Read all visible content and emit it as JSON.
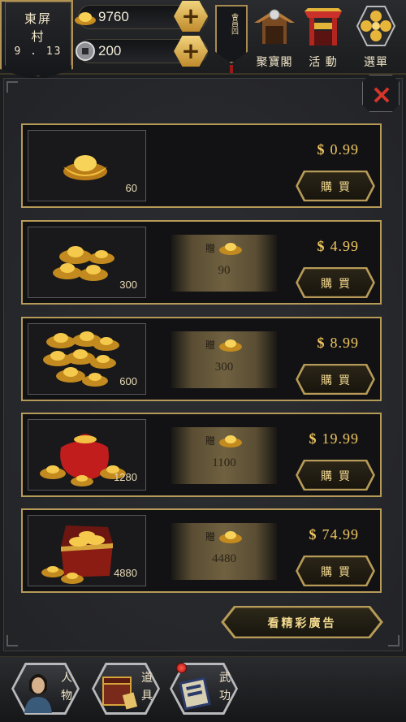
{
  "location": {
    "name_line1": "東屏",
    "name_line2": "村",
    "date": "9 . 13"
  },
  "currencies": {
    "gold": "9760",
    "coin": "200"
  },
  "season": {
    "label": "會員四"
  },
  "top_menu": [
    {
      "label": "聚寶閣",
      "icon": "treasure-pavilion-icon"
    },
    {
      "label": "活 動",
      "icon": "event-gate-icon"
    },
    {
      "label": "選單",
      "icon": "menu-flower-icon"
    }
  ],
  "close_label": "×",
  "offers": [
    {
      "quantity": "60",
      "price": "0.99",
      "bonus": "",
      "buy_label": "購買"
    },
    {
      "quantity": "300",
      "price": "4.99",
      "bonus": "90",
      "buy_label": "購買"
    },
    {
      "quantity": "600",
      "price": "8.99",
      "bonus": "300",
      "buy_label": "購買"
    },
    {
      "quantity": "1280",
      "price": "19.99",
      "bonus": "1100",
      "buy_label": "購買"
    },
    {
      "quantity": "4880",
      "price": "74.99",
      "bonus": "4480",
      "buy_label": "購買"
    }
  ],
  "currency_symbol": "$",
  "bonus_prefix": "贈",
  "ad_button_label": "看精彩廣告",
  "bottom_nav": [
    {
      "label_top": "人",
      "label_bottom": "物",
      "icon": "character-portrait-icon"
    },
    {
      "label_top": "道",
      "label_bottom": "具",
      "icon": "items-chest-icon"
    },
    {
      "label_top": "武",
      "label_bottom": "功",
      "icon": "martial-arts-scroll-icon"
    }
  ],
  "colors": {
    "accent_gold": "#b69a58",
    "price": "#f0c760",
    "close": "#d8352c"
  }
}
